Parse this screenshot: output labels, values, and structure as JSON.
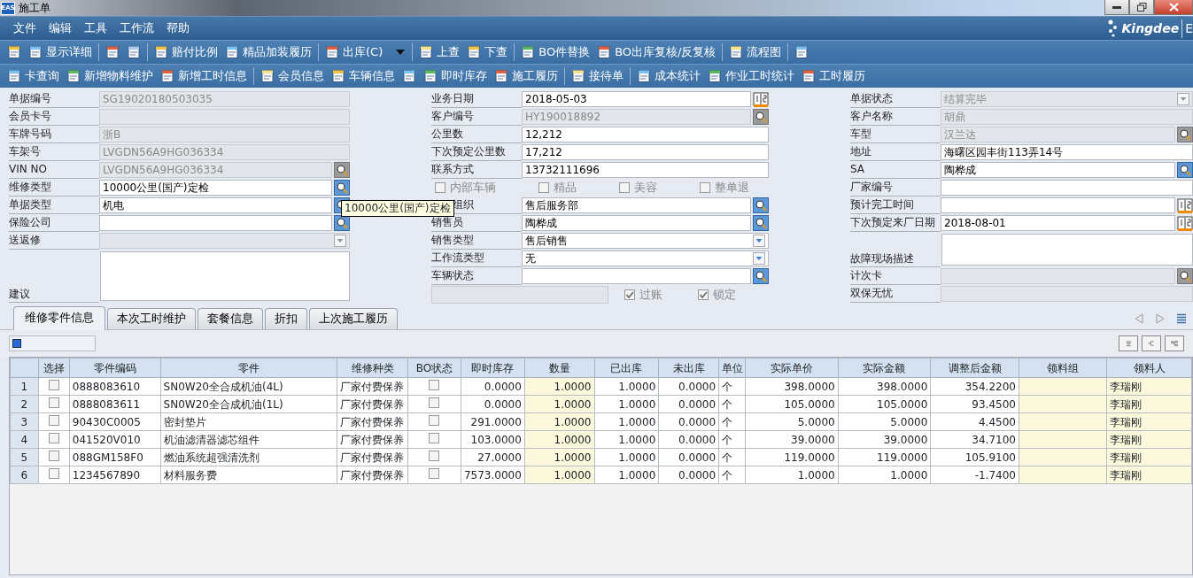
{
  "window": {
    "app_logo": "EAS",
    "title": "施工单"
  },
  "menu": [
    "文件",
    "编辑",
    "工具",
    "工作流",
    "帮助"
  ],
  "brand": {
    "name": "Kingdee",
    "suffix": "E"
  },
  "toolbars": [
    [
      {
        "kind": "icon"
      },
      {
        "kind": "button",
        "label": "显示详细"
      },
      {
        "kind": "separator"
      },
      {
        "kind": "icon"
      },
      {
        "kind": "icon"
      },
      {
        "kind": "separator"
      },
      {
        "kind": "button",
        "label": "赔付比例"
      },
      {
        "kind": "button",
        "label": "精品加装履历"
      },
      {
        "kind": "separator"
      },
      {
        "kind": "menu",
        "label": "出库(C)"
      },
      {
        "kind": "separator"
      },
      {
        "kind": "button",
        "label": "上查"
      },
      {
        "kind": "button",
        "label": "下查"
      },
      {
        "kind": "separator"
      },
      {
        "kind": "button",
        "label": "BO件替换"
      },
      {
        "kind": "button",
        "label": "BO出库复核/反复核"
      },
      {
        "kind": "separator"
      },
      {
        "kind": "button",
        "label": "流程图"
      },
      {
        "kind": "separator"
      },
      {
        "kind": "icon"
      }
    ],
    [
      {
        "kind": "button",
        "label": "卡查询"
      },
      {
        "kind": "button",
        "label": "新增物料维护"
      },
      {
        "kind": "button",
        "label": "新增工时信息"
      },
      {
        "kind": "separator"
      },
      {
        "kind": "button",
        "label": "会员信息"
      },
      {
        "kind": "button",
        "label": "车辆信息"
      },
      {
        "kind": "icon"
      },
      {
        "kind": "button",
        "label": "即时库存"
      },
      {
        "kind": "button",
        "label": "施工履历"
      },
      {
        "kind": "separator"
      },
      {
        "kind": "button",
        "label": "接待单"
      },
      {
        "kind": "separator"
      },
      {
        "kind": "button",
        "label": "成本统计"
      },
      {
        "kind": "button",
        "label": "作业工时统计"
      },
      {
        "kind": "button",
        "label": "工时履历"
      }
    ]
  ],
  "form": {
    "columns": [
      [
        {
          "label": "单据编号",
          "kind": "text",
          "readonly": true,
          "value": "SG19020180503035"
        },
        {
          "label": "会员卡号",
          "kind": "text",
          "readonly": true
        },
        {
          "label": "车牌号码",
          "kind": "text",
          "readonly": true,
          "value": "浙B"
        },
        {
          "label": "车架号",
          "kind": "text",
          "readonly": true,
          "value": "LVGDN56A9HG036334"
        },
        {
          "label": "VIN NO",
          "kind": "lookup",
          "readonly": true,
          "value": "LVGDN56A9HG036334"
        },
        {
          "label": "维修类型",
          "kind": "lookup",
          "readonly": false,
          "value": "10000公里(国产)定检"
        },
        {
          "label": "单据类型",
          "kind": "lookup",
          "readonly": false,
          "value": "机电"
        },
        {
          "label": "保险公司",
          "kind": "lookup",
          "readonly": false
        },
        {
          "label": "送返修",
          "kind": "dropdown",
          "readonly": true
        },
        {
          "label": "建议",
          "kind": "textarea",
          "readonly": false
        }
      ],
      [
        {
          "label": "业务日期",
          "kind": "date",
          "readonly": false,
          "value": "2018-05-03"
        },
        {
          "label": "客户编号",
          "kind": "lookup",
          "readonly": true,
          "value": "HY190018892"
        },
        {
          "label": "公里数",
          "kind": "text",
          "readonly": false,
          "value": "12,212"
        },
        {
          "label": "下次预定公里数",
          "kind": "text",
          "readonly": false,
          "value": "17,212"
        },
        {
          "label": "联系方式",
          "kind": "text",
          "readonly": false,
          "value": "13732111696"
        },
        {
          "kind": "checks",
          "items": [
            {
              "label": "内部车辆",
              "checked": false
            },
            {
              "label": "精品",
              "checked": false
            },
            {
              "label": "美容",
              "checked": false
            },
            {
              "label": "整单退",
              "checked": false
            }
          ]
        },
        {
          "label": "组织",
          "kind": "lookup",
          "readonly": false,
          "value": "售后服务部",
          "partly_covered": true
        },
        {
          "label": "销售员",
          "kind": "lookup",
          "readonly": false,
          "value": "陶桦成"
        },
        {
          "label": "销售类型",
          "kind": "dropdown",
          "readonly": false,
          "value": "售后销售"
        },
        {
          "label": "工作流类型",
          "kind": "dropdown",
          "readonly": false,
          "value": "无"
        },
        {
          "label": "车辆状态",
          "kind": "lookup",
          "readonly": false
        },
        {
          "kind": "postrow",
          "items": [
            {
              "label": "过账",
              "checked": true
            },
            {
              "label": "锁定",
              "checked": true
            }
          ]
        }
      ],
      [
        {
          "label": "单据状态",
          "kind": "dropdown",
          "readonly": true,
          "value": "结算完毕"
        },
        {
          "label": "客户名称",
          "kind": "text",
          "readonly": true,
          "value": "胡鼎"
        },
        {
          "label": "车型",
          "kind": "lookup",
          "readonly": true,
          "value": "汉兰达"
        },
        {
          "label": "地址",
          "kind": "text",
          "readonly": false,
          "value": "海曙区园丰街113弄14号"
        },
        {
          "label": "SA",
          "kind": "lookup",
          "readonly": false,
          "value": "陶桦成"
        },
        {
          "label": "厂家编号",
          "kind": "text",
          "readonly": false
        },
        {
          "label": "预计完工时间",
          "kind": "date",
          "readonly": false
        },
        {
          "label": "下次预定来厂日期",
          "kind": "date",
          "readonly": false,
          "value": "2018-08-01"
        },
        {
          "label": "故障现场描述",
          "kind": "textarea2",
          "readonly": false
        },
        {
          "label": "计次卡",
          "kind": "lookup",
          "readonly": true
        },
        {
          "label": "双保无忧",
          "kind": "text",
          "readonly": true
        }
      ]
    ],
    "tooltip": "10000公里(国产)定检"
  },
  "tabs": [
    {
      "label": "维修零件信息",
      "selected": true
    },
    {
      "label": "本次工时维护",
      "selected": false
    },
    {
      "label": "套餐信息",
      "selected": false
    },
    {
      "label": "折扣",
      "selected": false
    },
    {
      "label": "上次施工履历",
      "selected": false
    }
  ],
  "table": {
    "columns": [
      "",
      "选择",
      "零件编码",
      "零件",
      "维修种类",
      "BO状态",
      "即时库存",
      "数量",
      "已出库",
      "未出库",
      "单位",
      "实际单价",
      "实际金额",
      "调整后金额",
      "领料组",
      "领料人"
    ],
    "rows": [
      {
        "no": "1",
        "checked": false,
        "code": "0888083610",
        "part": "SN0W20全合成机油(4L)",
        "type": "厂家付费保养",
        "bo": false,
        "stock": "0.0000",
        "qty": "1.0000",
        "out": "1.0000",
        "notout": "0.0000",
        "unit": "个",
        "price": "398.0000",
        "amount": "398.0000",
        "adjusted": "354.2200",
        "picker": "李瑞刚"
      },
      {
        "no": "2",
        "checked": false,
        "code": "0888083611",
        "part": "SN0W20全合成机油(1L)",
        "type": "厂家付费保养",
        "bo": false,
        "stock": "0.0000",
        "qty": "1.0000",
        "out": "1.0000",
        "notout": "0.0000",
        "unit": "个",
        "price": "105.0000",
        "amount": "105.0000",
        "adjusted": "93.4500",
        "picker": "李瑞刚"
      },
      {
        "no": "3",
        "checked": false,
        "code": "90430C0005",
        "part": "密封垫片",
        "type": "厂家付费保养",
        "bo": false,
        "stock": "291.0000",
        "qty": "1.0000",
        "out": "1.0000",
        "notout": "0.0000",
        "unit": "个",
        "price": "5.0000",
        "amount": "5.0000",
        "adjusted": "4.4500",
        "picker": "李瑞刚"
      },
      {
        "no": "4",
        "checked": false,
        "code": "041520V010",
        "part": "机油滤清器滤芯组件",
        "type": "厂家付费保养",
        "bo": false,
        "stock": "103.0000",
        "qty": "1.0000",
        "out": "1.0000",
        "notout": "0.0000",
        "unit": "个",
        "price": "39.0000",
        "amount": "39.0000",
        "adjusted": "34.7100",
        "picker": "李瑞刚"
      },
      {
        "no": "5",
        "checked": false,
        "code": "088GM158F0",
        "part": "燃油系统超强清洗剂",
        "type": "厂家付费保养",
        "bo": false,
        "stock": "27.0000",
        "qty": "1.0000",
        "out": "1.0000",
        "notout": "0.0000",
        "unit": "个",
        "price": "119.0000",
        "amount": "119.0000",
        "adjusted": "105.9100",
        "picker": "李瑞刚"
      },
      {
        "no": "6",
        "checked": false,
        "code": "1234567890",
        "part": "材料服务费",
        "type": "厂家付费保养",
        "bo": false,
        "stock": "7573.0000",
        "qty": "1.0000",
        "out": "1.0000",
        "notout": "0.0000",
        "unit": "个",
        "price": "1.0000",
        "amount": "1.0000",
        "adjusted": "-1.7400",
        "picker": "李瑞刚"
      }
    ]
  }
}
